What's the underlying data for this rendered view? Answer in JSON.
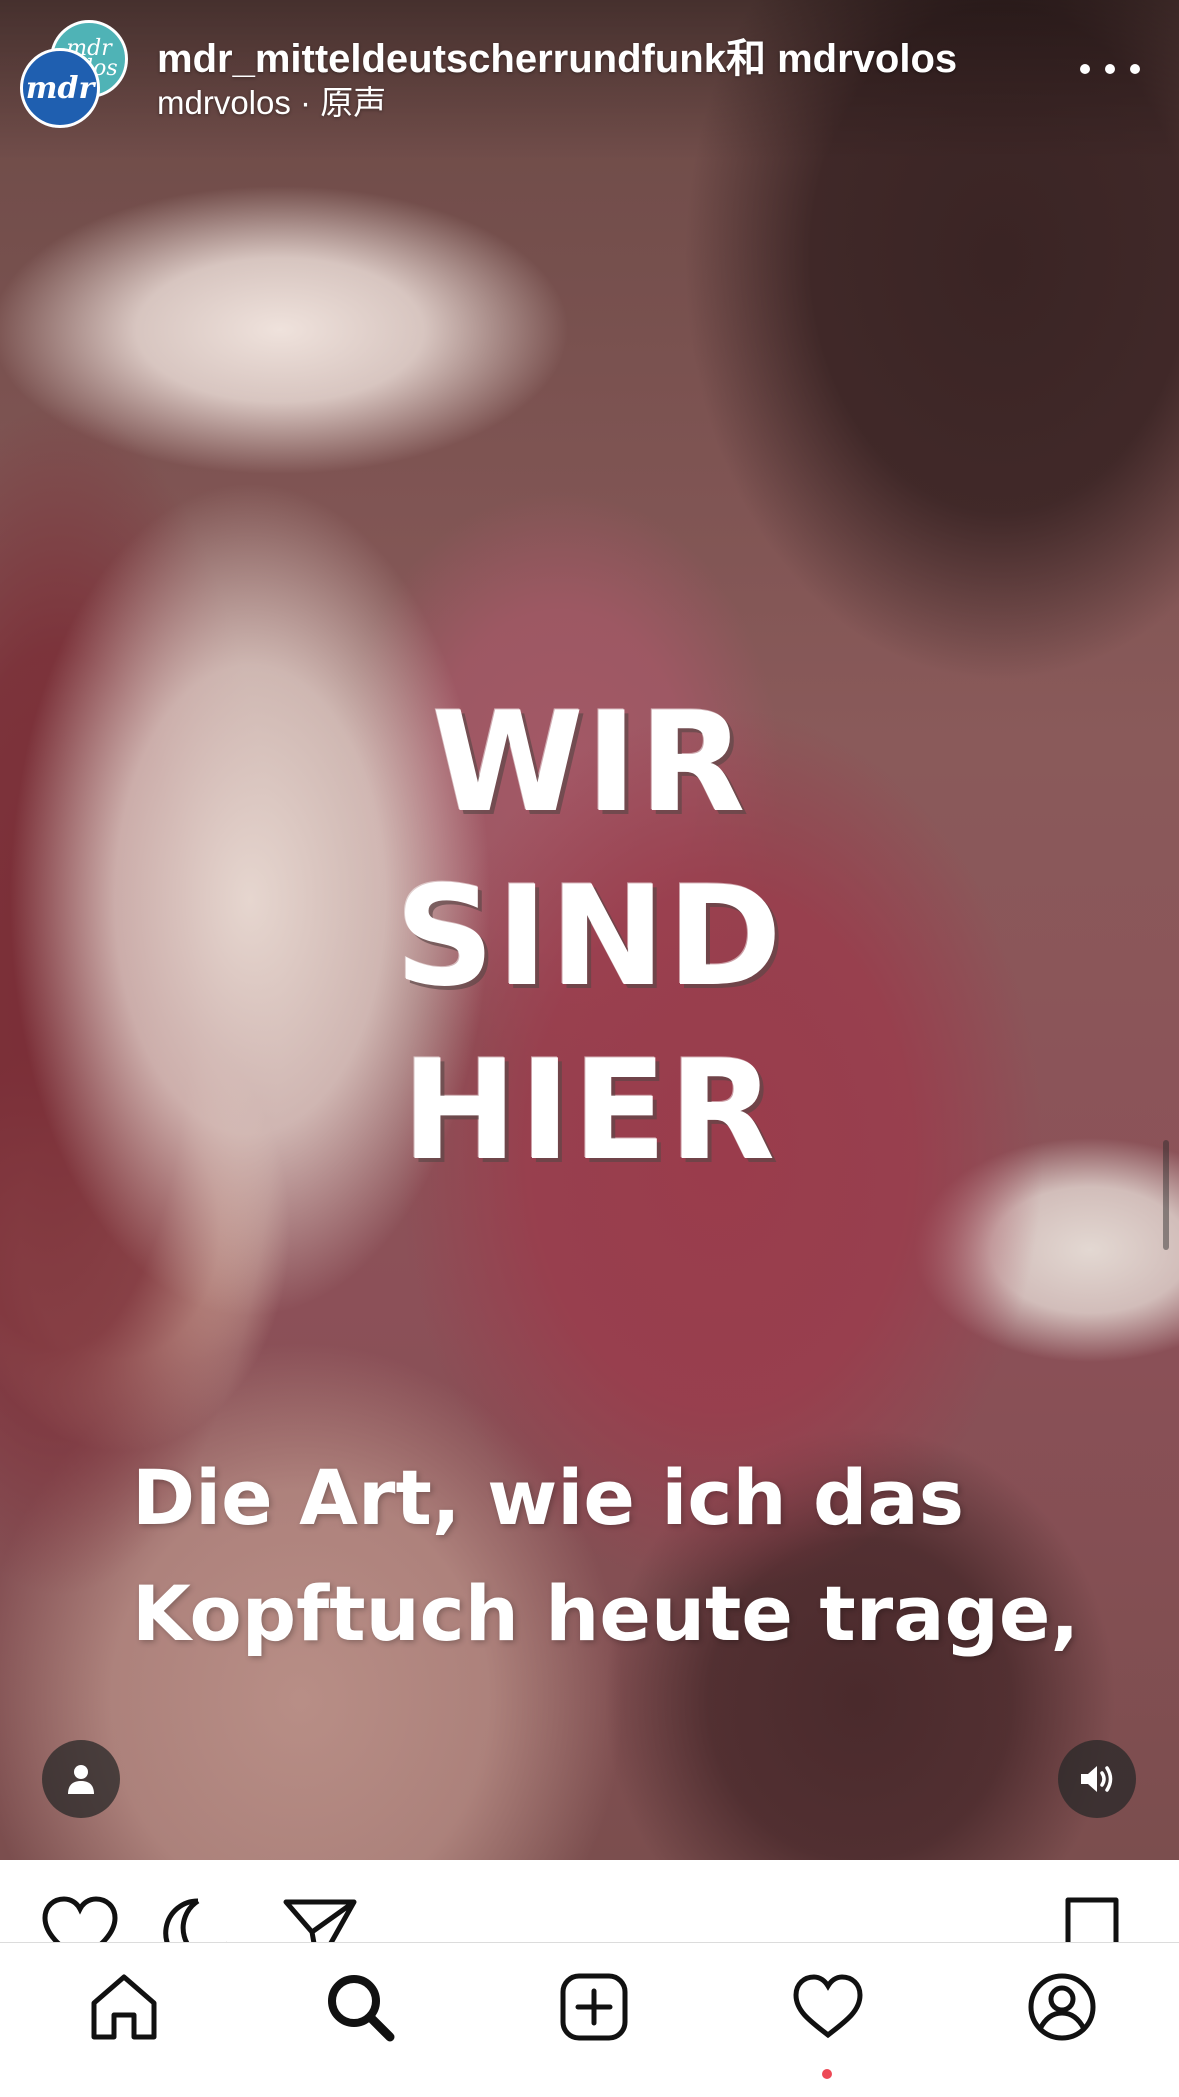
{
  "post": {
    "header": {
      "title": "mdr_mitteldeutscherrundfunk和 mdrvolos",
      "subtitle": "mdrvolos · 原声",
      "avatar_back_text": "mdr\nvolos",
      "avatar_front_text": "mdr"
    },
    "video": {
      "overlay_title_lines": [
        "WIR",
        "SIND",
        "HIER"
      ],
      "caption_lines": [
        "Die Art, wie ich das",
        "Kopftuch heute trage,"
      ]
    },
    "controls": {
      "user_tag_icon": "person-icon",
      "audio_icon": "speaker-on-icon"
    },
    "actions": [
      "heart-icon",
      "comment-icon",
      "share-icon",
      "bookmark-icon"
    ]
  },
  "bottom_nav": {
    "items": [
      "home-icon",
      "search-icon",
      "add-post-icon",
      "activity-heart-icon",
      "profile-icon"
    ],
    "notification_dot_color": "#ed4956"
  }
}
